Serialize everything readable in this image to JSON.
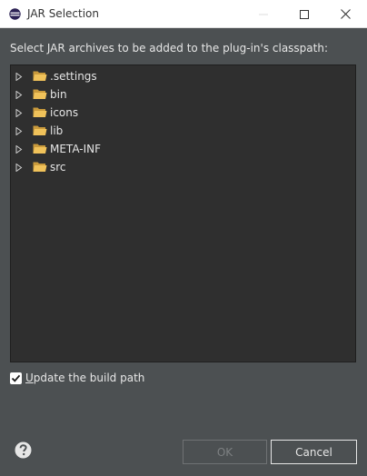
{
  "window": {
    "title": "JAR Selection",
    "icon": "eclipse-icon"
  },
  "dialog": {
    "instruction": "Select JAR archives to be added to the plug-in's classpath:",
    "tree_items": [
      {
        "label": ".settings",
        "icon": "folder-icon"
      },
      {
        "label": "bin",
        "icon": "folder-icon"
      },
      {
        "label": "icons",
        "icon": "folder-icon"
      },
      {
        "label": "lib",
        "icon": "folder-icon"
      },
      {
        "label": "META-INF",
        "icon": "folder-icon"
      },
      {
        "label": "src",
        "icon": "folder-icon"
      }
    ],
    "update_build_path": {
      "label_first_letter": "U",
      "label_rest": "pdate the build path",
      "checked": true
    }
  },
  "buttons": {
    "ok": "OK",
    "cancel": "Cancel"
  },
  "colors": {
    "background": "#4c5052",
    "tree_background": "#2f2f2f",
    "folder": "#e8b34a"
  }
}
